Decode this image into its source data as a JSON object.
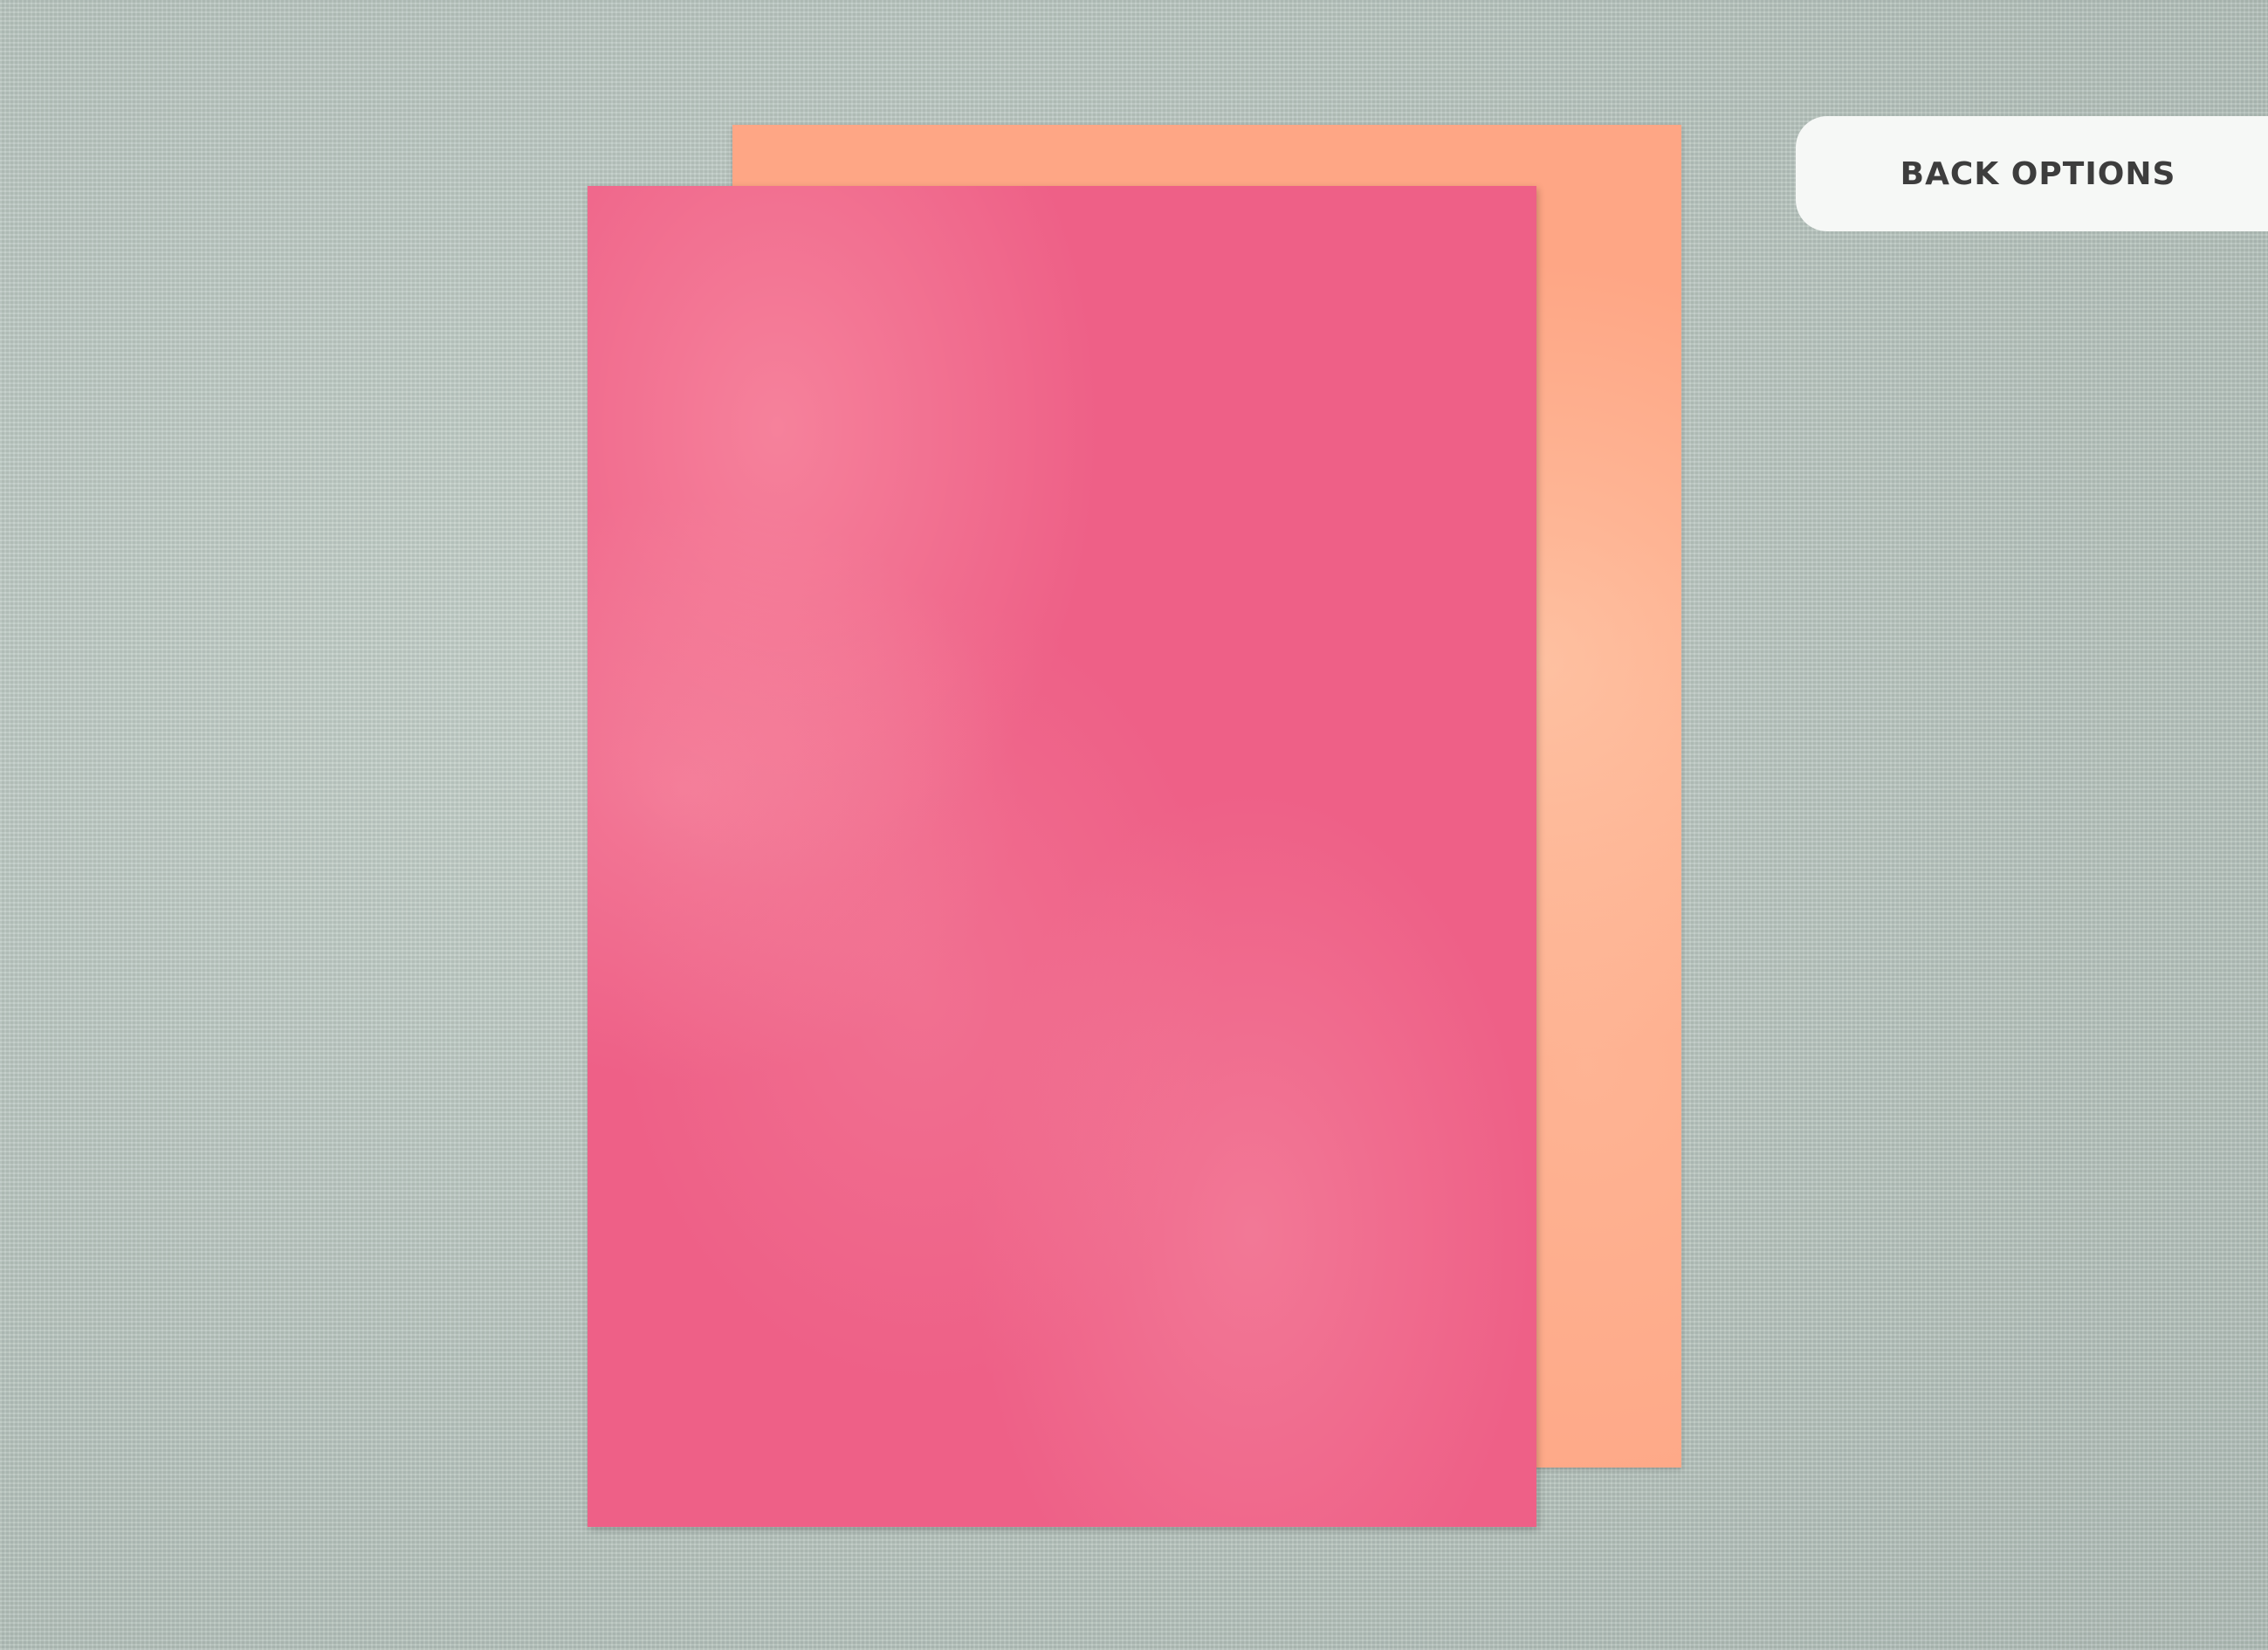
{
  "button": {
    "label": "BACK OPTIONS"
  },
  "colors": {
    "background": "#b9c6c0",
    "card_front": "#ee6087",
    "card_back": "#fea685",
    "button_bg": "#f6f8f6",
    "button_text": "#3d3d3d"
  }
}
